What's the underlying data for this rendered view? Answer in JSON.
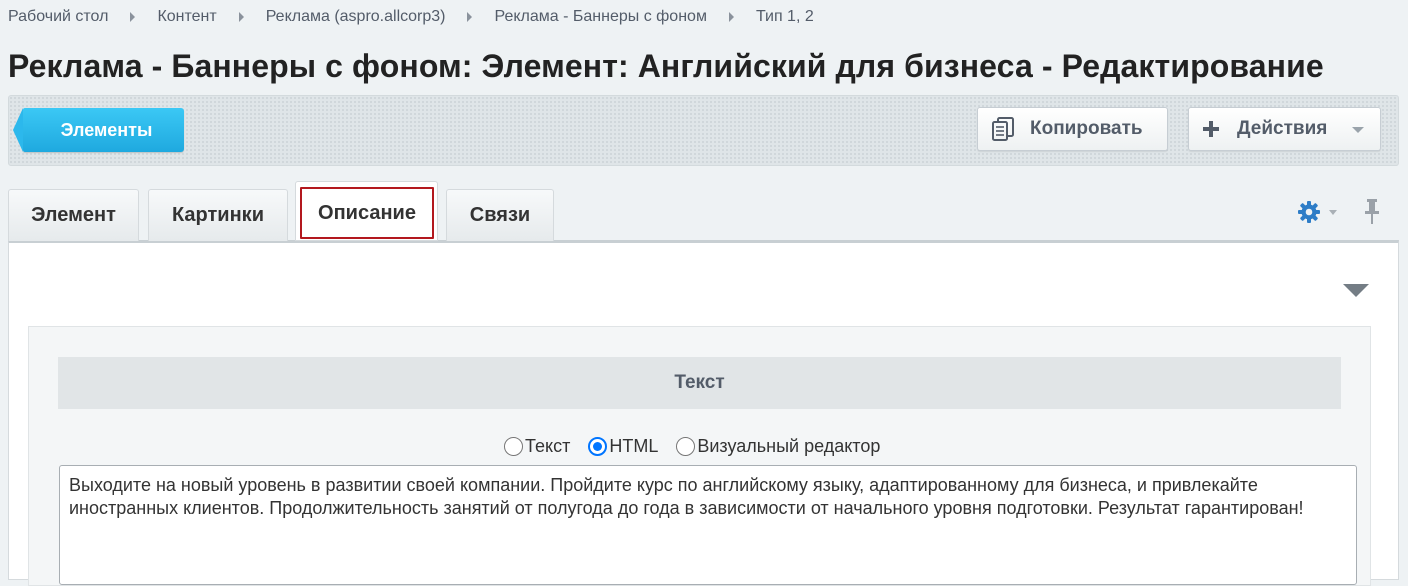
{
  "breadcrumb": [
    "Рабочий стол",
    "Контент",
    "Реклама (aspro.allcorp3)",
    "Реклама - Баннеры с фоном",
    "Тип 1, 2"
  ],
  "page_title": "Реклама - Баннеры с фоном: Элемент: Английский для бизнеса - Редактирование",
  "toolbar": {
    "elements_label": "Элементы",
    "copy_label": "Копировать",
    "actions_label": "Действия"
  },
  "tabs": [
    {
      "label": "Элемент",
      "active": false
    },
    {
      "label": "Картинки",
      "active": false
    },
    {
      "label": "Описание",
      "active": true
    },
    {
      "label": "Связи",
      "active": false
    }
  ],
  "section": {
    "title": "Текст"
  },
  "editor_modes": {
    "options": [
      "Текст",
      "HTML",
      "Визуальный редактор"
    ],
    "selected": "HTML"
  },
  "description_text": "Выходите на новый уровень в развитии своей компании. Пройдите курс по английскому языку, адаптированному для бизнеса, и привлекайте иностранных клиентов. Продолжительность занятий от полугода до года в зависимости от начального уровня подготовки. Результат гарантирован!",
  "colors": {
    "accent": "#2fc0f0",
    "tab_highlight": "#b3181e",
    "radio_selected": "#0075ff",
    "gear": "#2d7dc7"
  },
  "icons": [
    "copy-icon",
    "plus-icon",
    "chevron-down-icon",
    "gear-icon",
    "pin-icon",
    "collapse-arrow-icon"
  ]
}
